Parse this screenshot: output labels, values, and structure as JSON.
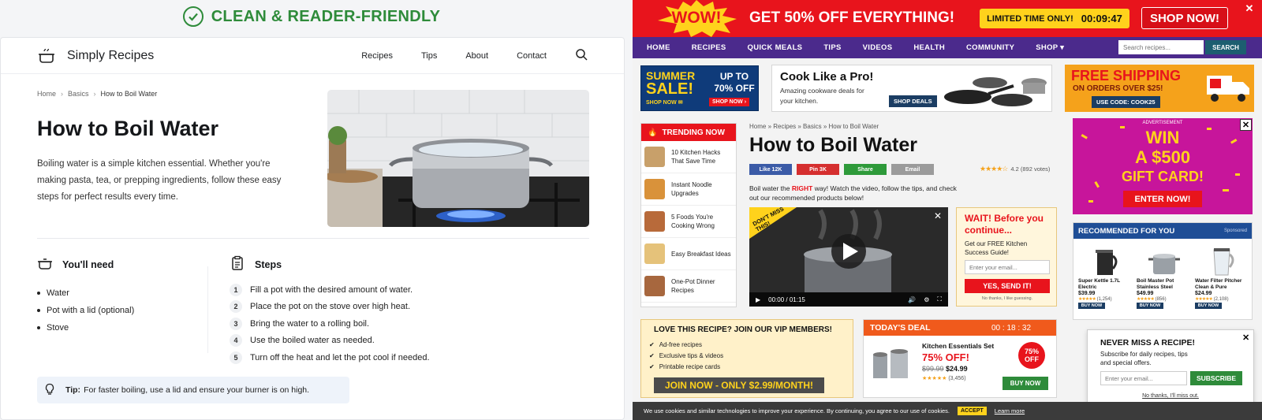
{
  "left_label": "CLEAN & READER-FRIENDLY",
  "clean": {
    "brand": "Simply Recipes",
    "nav": [
      "Recipes",
      "Tips",
      "About",
      "Contact"
    ],
    "breadcrumb": [
      "Home",
      "Basics",
      "How to Boil Water"
    ],
    "title": "How to Boil Water",
    "intro": "Boiling water is a simple kitchen essential. Whether you're making pasta, tea, or prepping ingredients, follow these easy steps for perfect results every time.",
    "need_title": "You'll need",
    "need": [
      "Water",
      "Pot with a lid (optional)",
      "Stove"
    ],
    "steps_title": "Steps",
    "steps": [
      "Fill a pot with the desired amount of water.",
      "Place the pot on the stove over high heat.",
      "Bring the water to a rolling boil.",
      "Use the boiled water as needed.",
      "Turn off the heat and let the pot cool if needed."
    ],
    "tip_label": "Tip:",
    "tip": "For faster boiling, use a lid and ensure your burner is on high."
  },
  "mess": {
    "wow": "WOW!",
    "promo": "GET 50% OFF EVERYTHING!",
    "limited": "LIMITED TIME ONLY!",
    "timer": "00:09:47",
    "shop_now": "SHOP NOW!",
    "nav": [
      "HOME",
      "RECIPES",
      "QUICK MEALS",
      "TIPS",
      "VIDEOS",
      "HEALTH",
      "COMMUNITY",
      "SHOP ▾"
    ],
    "search_placeholder": "Search recipes...",
    "search_btn": "SEARCH",
    "ad1": {
      "summer": "SUMMER",
      "sale": "SALE!",
      "shop": "SHOP NOW ✉",
      "upto": "UP TO 70% OFF",
      "btn": "SHOP NOW ›"
    },
    "ad2": {
      "title": "Cook Like a Pro!",
      "text": "Amazing cookware deals for your kitchen.",
      "btn": "SHOP DEALS"
    },
    "ad3": {
      "free": "FREE SHIPPING",
      "orders": "ON ORDERS OVER $25!",
      "code": "USE CODE: COOK25"
    },
    "trending_title": "TRENDING NOW",
    "trending": [
      "10 Kitchen Hacks That Save Time",
      "Instant Noodle Upgrades",
      "5 Foods You're Cooking Wrong",
      "Easy Breakfast Ideas",
      "One-Pot Dinner Recipes"
    ],
    "breadcrumb": "Home » Recipes » Basics » How to Boil Water",
    "title": "How to Boil Water",
    "share": [
      "Like 12K",
      "Pin 3K",
      "Share",
      "Email"
    ],
    "rating_value": "4.2 (892 votes)",
    "intro_a": "Boil water the ",
    "intro_right": "RIGHT",
    "intro_b": " way! Watch the video, follow the tips, and check out our recommended products below!",
    "video_badge": "DON'T MISS THIS!",
    "video_time": "00:00 / 01:15",
    "wait": {
      "title": "WAIT! Before you continue...",
      "text": "Get our FREE Kitchen Success Guide!",
      "placeholder": "Enter your email...",
      "btn": "YES, SEND IT!",
      "no": "No thanks, I like guessing."
    },
    "win": {
      "ad": "ADVERTISEMENT",
      "win": "WIN",
      "amt": "A $500",
      "gift": "GIFT CARD!",
      "btn": "ENTER NOW!"
    },
    "rec_title": "RECOMMENDED FOR YOU",
    "rec_sponsored": "Sponsored",
    "rec": [
      {
        "name": "Super Kettle 1.7L Electric",
        "price": "$39.99",
        "reviews": "(1,254)",
        "btn": "BUY NOW"
      },
      {
        "name": "Boil Master Pot Stainless Steel",
        "price": "$49.99",
        "reviews": "(856)",
        "btn": "BUY NOW"
      },
      {
        "name": "Water Filter Pitcher Clean & Pure",
        "price": "$24.99",
        "reviews": "(2,108)",
        "btn": "BUY NOW"
      }
    ],
    "vip": {
      "title": "LOVE THIS RECIPE? JOIN OUR VIP MEMBERS!",
      "items": [
        "Ad-free recipes",
        "Exclusive tips & videos",
        "Printable recipe cards"
      ],
      "btn": "JOIN NOW - ONLY $2.99/MONTH!"
    },
    "deal": {
      "title": "TODAY'S DEAL",
      "timer": "00 : 18 : 32",
      "name": "Kitchen Essentials Set",
      "off": "75% OFF!",
      "old": "$99.99",
      "new": "$24.99",
      "reviews": "(3,456)",
      "badge_a": "75%",
      "badge_b": "OFF",
      "btn": "BUY NOW"
    },
    "never": {
      "title": "NEVER MISS A RECIPE!",
      "text": "Subscribe for daily recipes, tips and special offers.",
      "placeholder": "Enter your email...",
      "btn": "SUBSCRIBE",
      "no": "No thanks, I'll miss out."
    },
    "cookie": {
      "text": "We use cookies and similar technologies to improve your experience. By continuing, you agree to our use of cookies.",
      "accept": "ACCEPT",
      "learn": "Learn more"
    }
  }
}
